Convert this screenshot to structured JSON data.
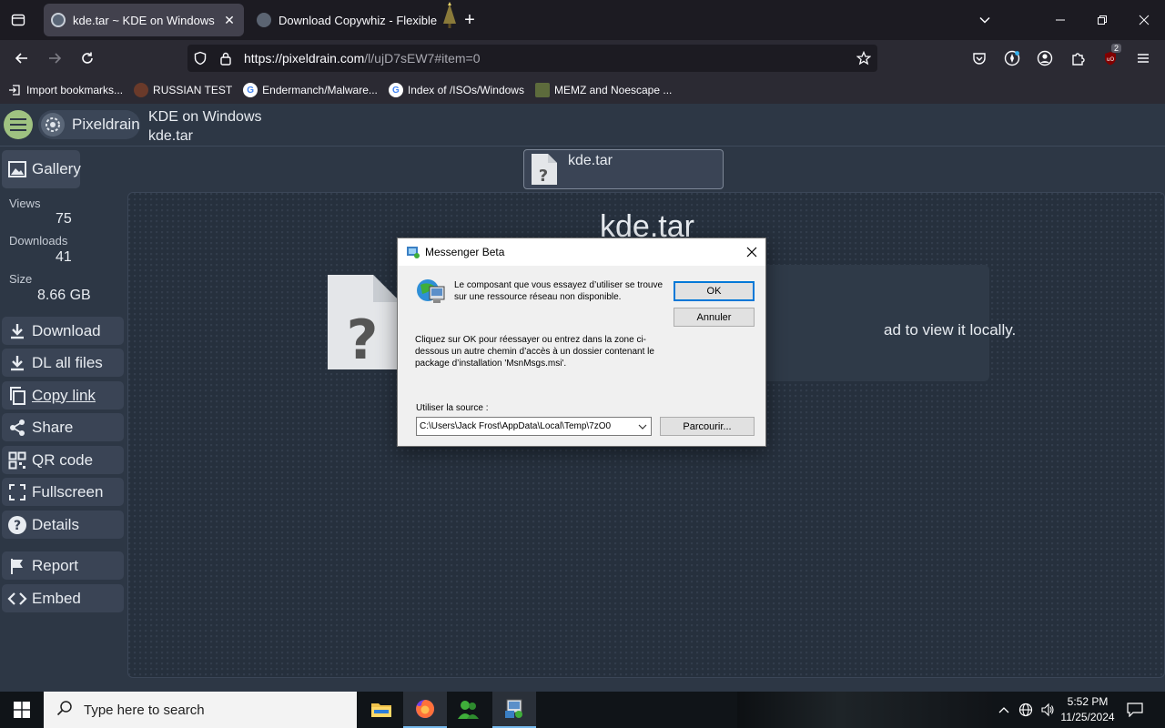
{
  "browser": {
    "tabs": [
      {
        "title": "kde.tar ~ KDE on Windows ~ pi",
        "active": true
      },
      {
        "title": "Download Copywhiz - Flexible",
        "active": false
      }
    ],
    "url_host": "https://pixeldrain.com",
    "url_path": "/l/ujD7sEW7#item=0",
    "extension_badge": "2",
    "bookmarks": [
      {
        "label": "Import bookmarks...",
        "icon": "import-icon"
      },
      {
        "label": "RUSSIAN TEST",
        "icon": "globe-icon"
      },
      {
        "label": "Endermanch/Malware...",
        "icon": "google-icon"
      },
      {
        "label": "Index of /ISOs/Windows",
        "icon": "google-icon"
      },
      {
        "label": "MEMZ and Noescape ...",
        "icon": "image-icon"
      }
    ]
  },
  "pixeldrain": {
    "logo_text": "Pixeldrain",
    "list_title": "KDE on Windows",
    "file_title": "kde.tar",
    "gallery_label": "Gallery",
    "stats": [
      {
        "label": "Views",
        "value": "75"
      },
      {
        "label": "Downloads",
        "value": "41"
      },
      {
        "label": "Size",
        "value": "8.66 GB"
      }
    ],
    "actions": [
      {
        "label": "Download",
        "icon": "download-icon"
      },
      {
        "label": "DL all files",
        "icon": "download-icon"
      },
      {
        "label": "Copy link",
        "icon": "copy-icon"
      },
      {
        "label": "Share",
        "icon": "share-icon"
      },
      {
        "label": "QR code",
        "icon": "qr-icon"
      },
      {
        "label": "Fullscreen",
        "icon": "fullscreen-icon"
      },
      {
        "label": "Details",
        "icon": "help-icon"
      },
      {
        "label": "Report",
        "icon": "flag-icon"
      },
      {
        "label": "Embed",
        "icon": "code-icon"
      }
    ],
    "file_tab_name": "kde.tar",
    "viewer_title": "kde.tar",
    "viewer_message_partial": "ad to view it locally."
  },
  "dialog": {
    "title": "Messenger Beta",
    "message1": "Le composant que vous essayez d’utiliser se trouve sur une ressource réseau non disponible.",
    "message2": "Cliquez sur OK pour réessayer ou entrez dans la zone ci-dessous un autre chemin d’accès à un dossier contenant le package d’installation 'MsnMsgs.msi'.",
    "ok_label": "OK",
    "cancel_label": "Annuler",
    "source_label": "Utiliser la source :",
    "source_value": "C:\\Users\\Jack Frost\\AppData\\Local\\Temp\\7zO0",
    "browse_label": "Parcourir..."
  },
  "taskbar": {
    "search_placeholder": "Type here to search",
    "time": "5:52 PM",
    "date": "11/25/2024"
  },
  "colors": {
    "accent_green": "#9fc281",
    "page_bg": "#2d3745",
    "dialog_focus": "#0078d7"
  }
}
